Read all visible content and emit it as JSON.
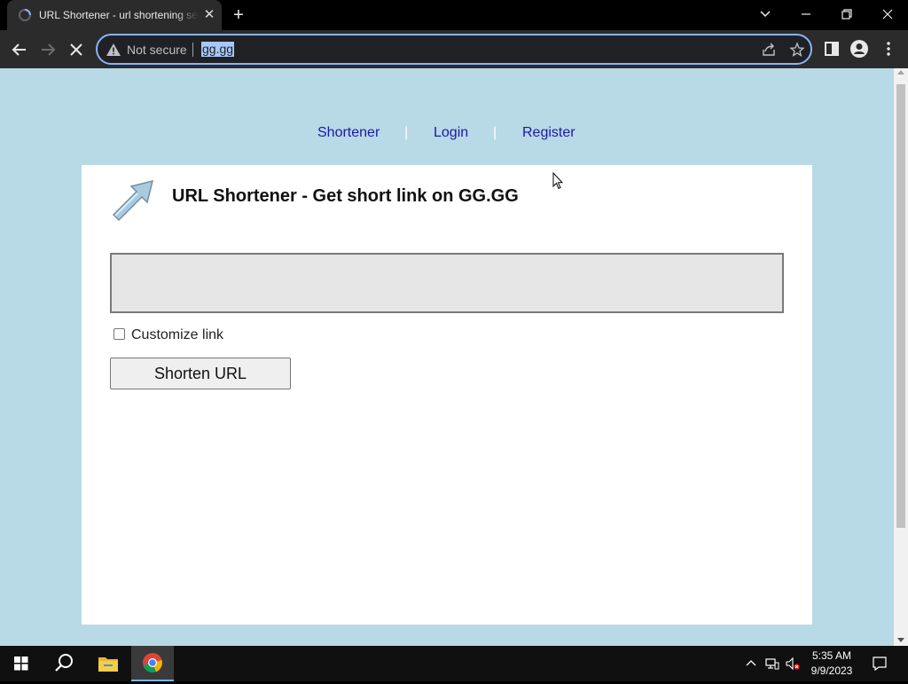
{
  "browser": {
    "tab_title": "URL Shortener - url shortening service",
    "tab_close": "✕",
    "new_tab": "+",
    "security_label": "Not secure",
    "address": "gg.gg"
  },
  "page": {
    "nav": {
      "shortener": "Shortener",
      "login": "Login",
      "register": "Register",
      "separator": "|"
    },
    "heading": "URL Shortener - Get short link on GG.GG",
    "url_input": {
      "value": "",
      "placeholder": ""
    },
    "customize_label": "Customize link",
    "customize_checked": false,
    "shorten_button": "Shorten URL"
  },
  "taskbar": {
    "time": "5:35 AM",
    "date": "9/9/2023"
  },
  "colors": {
    "page_background": "#b8d9e6",
    "nav_link": "#1a1aa6",
    "omnibox_focus": "#8ab4f8"
  }
}
